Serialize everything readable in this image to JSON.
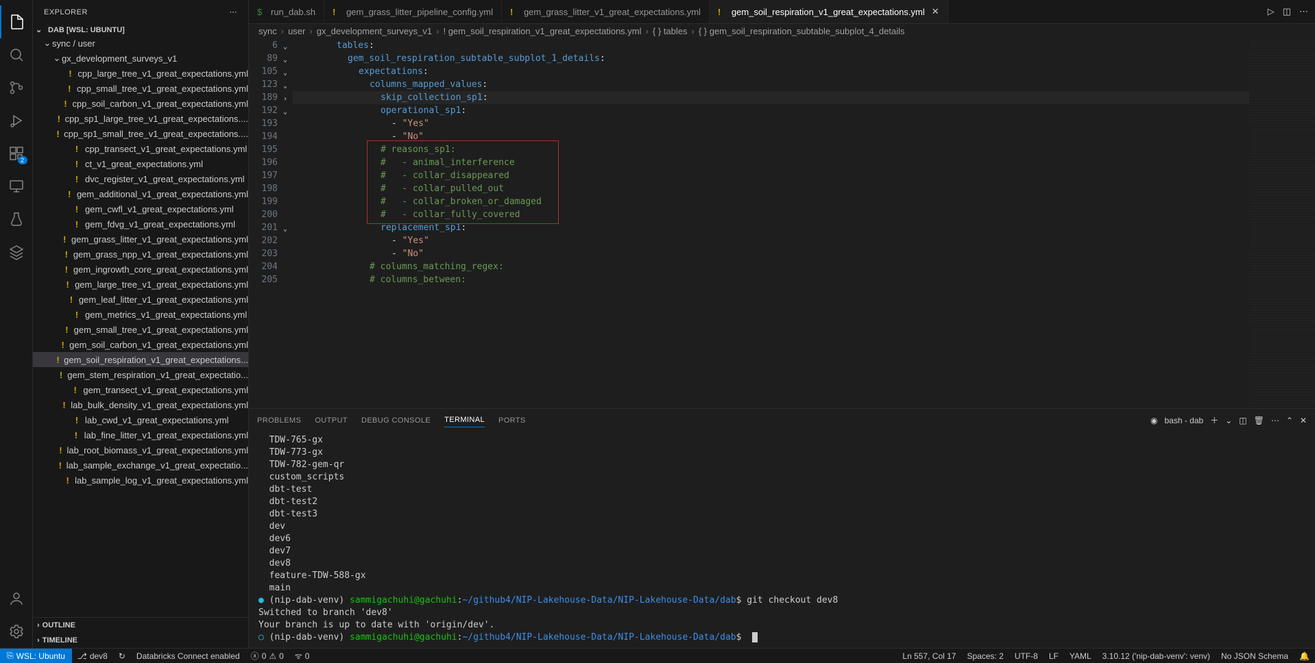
{
  "sidebar": {
    "title": "EXPLORER",
    "workspace": "DAB [WSL: UBUNTU]",
    "tree": {
      "folder1": "sync / user",
      "folder2": "gx_development_surveys_v1",
      "files": [
        "cpp_large_tree_v1_great_expectations.yml",
        "cpp_small_tree_v1_great_expectations.yml",
        "cpp_soil_carbon_v1_great_expectations.yml",
        "cpp_sp1_large_tree_v1_great_expectations....",
        "cpp_sp1_small_tree_v1_great_expectations....",
        "cpp_transect_v1_great_expectations.yml",
        "ct_v1_great_expectations.yml",
        "dvc_register_v1_great_expectations.yml",
        "gem_additional_v1_great_expectations.yml",
        "gem_cwfl_v1_great_expectations.yml",
        "gem_fdvg_v1_great_expectations.yml",
        "gem_grass_litter_v1_great_expectations.yml",
        "gem_grass_npp_v1_great_expectations.yml",
        "gem_ingrowth_core_great_expectations.yml",
        "gem_large_tree_v1_great_expectations.yml",
        "gem_leaf_litter_v1_great_expectations.yml",
        "gem_metrics_v1_great_expectations.yml",
        "gem_small_tree_v1_great_expectations.yml",
        "gem_soil_carbon_v1_great_expectations.yml",
        "gem_soil_respiration_v1_great_expectations...",
        "gem_stem_respiration_v1_great_expectatio...",
        "gem_transect_v1_great_expectations.yml",
        "lab_bulk_density_v1_great_expectations.yml",
        "lab_cwd_v1_great_expectations.yml",
        "lab_fine_litter_v1_great_expectations.yml",
        "lab_root_biomass_v1_great_expectations.yml",
        "lab_sample_exchange_v1_great_expectatio...",
        "lab_sample_log_v1_great_expectations.yml"
      ],
      "selectedIndex": 19
    },
    "outline": "OUTLINE",
    "timeline": "TIMELINE"
  },
  "tabs": {
    "items": [
      {
        "label": "run_dab.sh",
        "icon": "bash"
      },
      {
        "label": "gem_grass_litter_pipeline_config.yml",
        "icon": "yaml"
      },
      {
        "label": "gem_grass_litter_v1_great_expectations.yml",
        "icon": "yaml"
      },
      {
        "label": "gem_soil_respiration_v1_great_expectations.yml",
        "icon": "yaml",
        "active": true
      }
    ]
  },
  "breadcrumbs": {
    "parts": [
      "sync",
      "user",
      "gx_development_surveys_v1",
      "gem_soil_respiration_v1_great_expectations.yml",
      "tables",
      "gem_soil_respiration_subtable_subplot_4_details"
    ]
  },
  "editor": {
    "lineNumbers": [
      "6",
      "89",
      "105",
      "123",
      "189",
      "192",
      "193",
      "194",
      "195",
      "196",
      "197",
      "198",
      "199",
      "200",
      "201",
      "202",
      "203",
      "204",
      "205"
    ],
    "lines": [
      {
        "indent": 4,
        "html": "<span class='tok-key'>tables</span>:"
      },
      {
        "indent": 5,
        "html": "<span class='tok-key'>gem_soil_respiration_subtable_subplot_1_details</span>:"
      },
      {
        "indent": 6,
        "html": "<span class='tok-key'>expectations</span>:"
      },
      {
        "indent": 7,
        "html": "<span class='tok-key'>columns_mapped_values</span>:"
      },
      {
        "indent": 8,
        "html": "<span class='tok-key'>skip_collection_sp1</span>:",
        "current": true
      },
      {
        "indent": 8,
        "html": "<span class='tok-key'>operational_sp1</span>:"
      },
      {
        "indent": 9,
        "html": "<span class='tok-dash'>- </span><span class='tok-str'>\"Yes\"</span>"
      },
      {
        "indent": 9,
        "html": "<span class='tok-dash'>- </span><span class='tok-str'>\"No\"</span>"
      },
      {
        "indent": 8,
        "html": "<span class='tok-cmt'># reasons_sp1:</span>"
      },
      {
        "indent": 8,
        "html": "<span class='tok-cmt'>#   - animal_interference</span>"
      },
      {
        "indent": 8,
        "html": "<span class='tok-cmt'>#   - collar_disappeared</span>"
      },
      {
        "indent": 8,
        "html": "<span class='tok-cmt'>#   - collar_pulled_out</span>"
      },
      {
        "indent": 8,
        "html": "<span class='tok-cmt'>#   - collar_broken_or_damaged</span>"
      },
      {
        "indent": 8,
        "html": "<span class='tok-cmt'>#   - collar_fully_covered</span>"
      },
      {
        "indent": 8,
        "html": "<span class='tok-key'>replacement_sp1</span>:"
      },
      {
        "indent": 9,
        "html": "<span class='tok-dash'>- </span><span class='tok-str'>\"Yes\"</span>"
      },
      {
        "indent": 9,
        "html": "<span class='tok-dash'>- </span><span class='tok-str'>\"No\"</span>"
      },
      {
        "indent": 7,
        "html": "<span class='tok-cmt'># columns_matching_regex:</span>"
      },
      {
        "indent": 7,
        "html": "<span class='tok-cmt'># columns_between:</span>"
      }
    ],
    "highlight": {
      "topLine": 8,
      "lineCount": 6
    }
  },
  "panel": {
    "tabs": [
      "PROBLEMS",
      "OUTPUT",
      "DEBUG CONSOLE",
      "TERMINAL",
      "PORTS"
    ],
    "activeTab": 3,
    "termLabel": "bash - dab",
    "terminalLines": [
      {
        "plain": "  TDW-765-gx"
      },
      {
        "plain": "  TDW-773-gx"
      },
      {
        "plain": "  TDW-782-gem-qr"
      },
      {
        "plain": "  custom_scripts"
      },
      {
        "plain": "  dbt-test"
      },
      {
        "plain": "  dbt-test2"
      },
      {
        "plain": "  dbt-test3"
      },
      {
        "plain": "  dev"
      },
      {
        "plain": "  dev6"
      },
      {
        "plain": "  dev7"
      },
      {
        "plain": "  dev8"
      },
      {
        "plain": "  feature-TDW-588-gx"
      },
      {
        "plain": "  main"
      },
      {
        "prompt": {
          "venv": "(nip-dab-venv)",
          "user": "sammigachuhi@gachuhi",
          "path": "~/github4/NIP-Lakehouse-Data/NIP-Lakehouse-Data/dab",
          "cmd": "git checkout dev8"
        },
        "dot": true
      },
      {
        "plain": "Switched to branch 'dev8'"
      },
      {
        "plain": "Your branch is up to date with 'origin/dev'."
      },
      {
        "prompt": {
          "venv": "(nip-dab-venv)",
          "user": "sammigachuhi@gachuhi",
          "path": "~/github4/NIP-Lakehouse-Data/NIP-Lakehouse-Data/dab",
          "cmd": ""
        },
        "dot": "hollow",
        "cursor": true
      }
    ]
  },
  "status": {
    "remote": "WSL: Ubuntu",
    "branch": "dev8",
    "sync": "↻",
    "databricks": "Databricks Connect enabled",
    "errors": "0",
    "warnings": "0",
    "ports": "0",
    "lncol": "Ln 557, Col 17",
    "spaces": "Spaces: 2",
    "encoding": "UTF-8",
    "eol": "LF",
    "lang": "YAML",
    "py": "3.10.12 ('nip-dab-venv': venv)",
    "schema": "No JSON Schema"
  },
  "ext_badge": "2"
}
